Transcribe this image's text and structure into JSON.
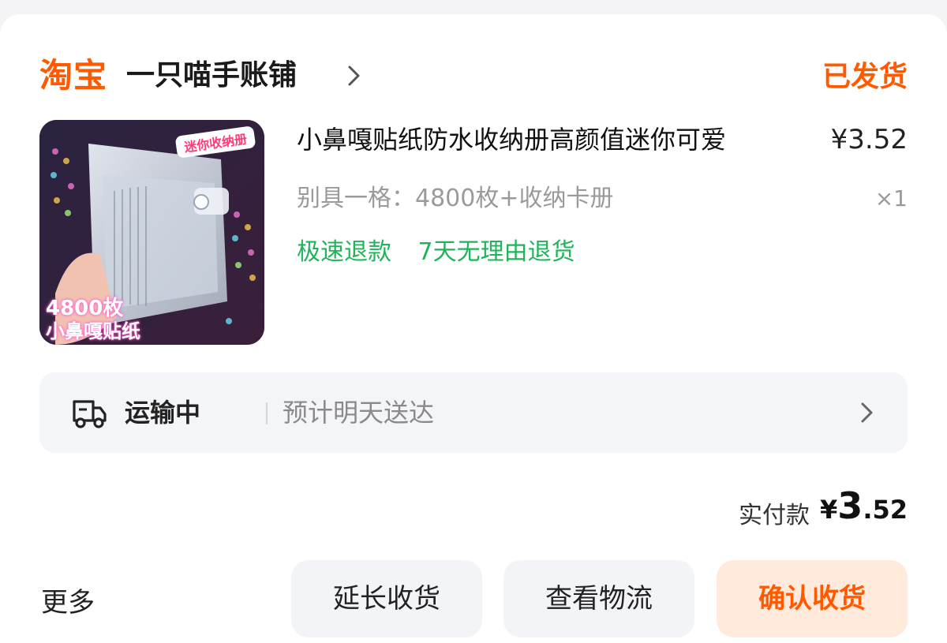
{
  "header": {
    "brand": "淘宝",
    "shop_name": "一只喵手账铺",
    "order_status": "已发货"
  },
  "product": {
    "title": "小鼻嘎贴纸防水收纳册高颜值迷你可爱",
    "price": "¥3.52",
    "sku": "别具一格：4800枚+收纳卡册",
    "quantity": "×1",
    "service_tags": [
      "极速退款",
      "7天无理由退货"
    ],
    "image_tag": "迷你收纳册",
    "image_caption_1": "4800枚",
    "image_caption_2": "小鼻嘎贴纸"
  },
  "logistics": {
    "status": "运输中",
    "eta": "预计明天送达"
  },
  "payment": {
    "label": "实付款",
    "currency": "¥",
    "amount_int": "3",
    "amount_dec": ".52"
  },
  "actions": {
    "more": "更多",
    "extend": "延长收货",
    "track": "查看物流",
    "confirm": "确认收货"
  },
  "colors": {
    "accent": "#ff5a00",
    "service_green": "#1fb45a"
  }
}
